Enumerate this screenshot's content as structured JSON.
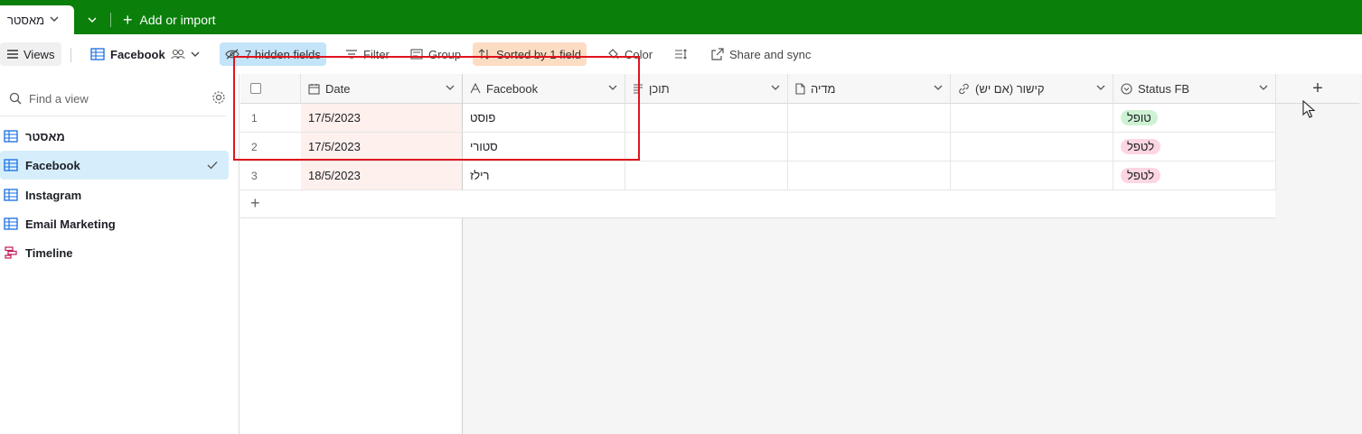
{
  "topbar": {
    "active_tab": "מאסטר",
    "add_import": "Add or import"
  },
  "toolbar": {
    "views": "Views",
    "current_view": "Facebook",
    "hidden_fields": "7 hidden fields",
    "filter": "Filter",
    "group": "Group",
    "sorted": "Sorted by 1 field",
    "color": "Color",
    "share": "Share and sync"
  },
  "sidebar": {
    "find_placeholder": "Find a view",
    "items": [
      {
        "label": "מאסטר"
      },
      {
        "label": "Facebook"
      },
      {
        "label": "Instagram"
      },
      {
        "label": "Email Marketing"
      },
      {
        "label": "Timeline"
      }
    ]
  },
  "grid": {
    "columns": [
      "Date",
      "Facebook",
      "תוכן",
      "מדיה",
      "קישור (אם יש)",
      "Status FB"
    ],
    "rows": [
      {
        "num": "1",
        "date": "17/5/2023",
        "facebook": "פוסט",
        "content": "",
        "media": "",
        "link": "",
        "status": "טופל"
      },
      {
        "num": "2",
        "date": "17/5/2023",
        "facebook": "סטורי",
        "content": "",
        "media": "",
        "link": "",
        "status": "לטפל"
      },
      {
        "num": "3",
        "date": "18/5/2023",
        "facebook": "רילז",
        "content": "",
        "media": "",
        "link": "",
        "status": "לטפל"
      }
    ]
  },
  "colors": {
    "topbar": "#0a7f0a",
    "accent": "#166ee1",
    "status_done": "#cdf2d3",
    "status_todo": "#fcd6e0",
    "highlight_box": "#e0141e"
  }
}
